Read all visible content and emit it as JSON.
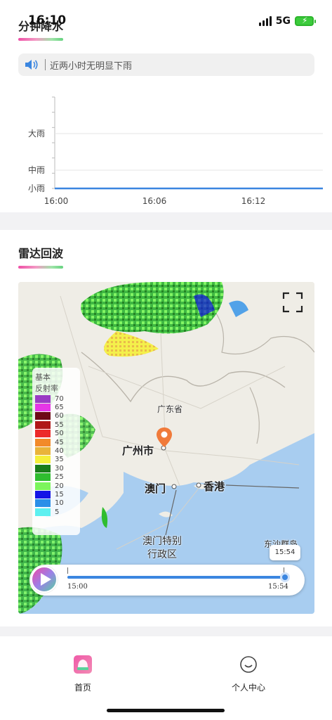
{
  "status_bar": {
    "time": "16:10",
    "network": "5G"
  },
  "minute_rain": {
    "title": "分钟降水",
    "notice": "近两小时无明显下雨",
    "notice_icon": "speaker-icon"
  },
  "chart_data": {
    "type": "line",
    "x": [
      "16:00",
      "16:06",
      "16:12"
    ],
    "y_labels": [
      "小雨",
      "中雨",
      "大雨"
    ],
    "series": [
      {
        "values": [
          0,
          0,
          0,
          0
        ]
      }
    ],
    "ylim": [
      0,
      3
    ],
    "color": "#3b86e0"
  },
  "radar": {
    "title": "雷达回波",
    "legend": {
      "title_line1": "基本",
      "title_line2": "反射率",
      "levels": [
        {
          "value": "70",
          "color": "#9a3bc4"
        },
        {
          "value": "65",
          "color": "#e636e6"
        },
        {
          "value": "60",
          "color": "#6e0a16"
        },
        {
          "value": "55",
          "color": "#b01818"
        },
        {
          "value": "50",
          "color": "#ec2a2a"
        },
        {
          "value": "45",
          "color": "#f28a2a"
        },
        {
          "value": "40",
          "color": "#e9b43a"
        },
        {
          "value": "35",
          "color": "#f5f03a"
        },
        {
          "value": "30",
          "color": "#1a7d1a"
        },
        {
          "value": "25",
          "color": "#2fbd2f"
        },
        {
          "value": "20",
          "color": "#7cf55c"
        },
        {
          "value": "15",
          "color": "#1414e6"
        },
        {
          "value": "10",
          "color": "#2b8fe8"
        },
        {
          "value": "5",
          "color": "#5ef0f0"
        }
      ]
    },
    "places": {
      "province": "广东省",
      "guangzhou": "广州市",
      "macau": "澳门",
      "hongkong": "香港",
      "macau_sar_line1": "澳门特别",
      "macau_sar_line2": "行政区",
      "dongsha": "东沙群岛"
    },
    "timeline": {
      "start": "15:00",
      "end": "15:54",
      "current": "15:54",
      "progress": 1.0
    }
  },
  "tabbar": {
    "home": "首页",
    "me": "个人中心"
  }
}
